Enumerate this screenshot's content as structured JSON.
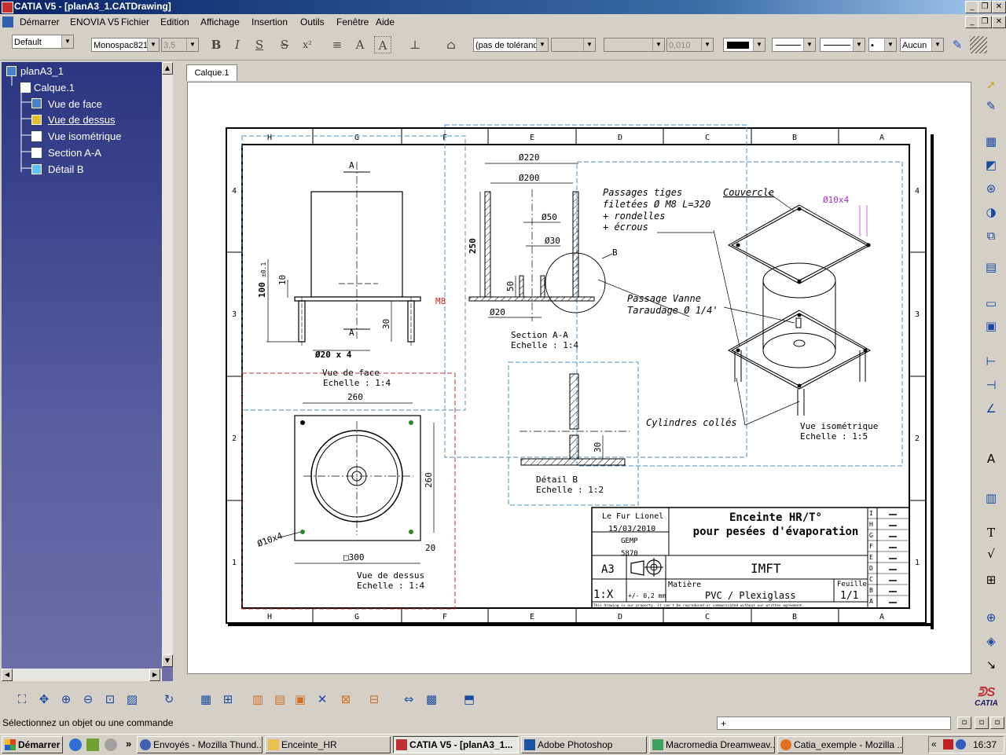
{
  "window": {
    "title": "CATIA V5 - [planA3_1.CATDrawing]"
  },
  "menu": [
    "Démarrer",
    "ENOVIA V5",
    "Fichier",
    "Edition",
    "Affichage",
    "Insertion",
    "Outils",
    "Fenêtre",
    "Aide"
  ],
  "toolbar": {
    "style_value": "Default",
    "font_value": "Monospac821",
    "font_size_value": "3,5",
    "bold": "B",
    "italic": "I",
    "underline": "S",
    "strike": "S",
    "superscript": "x²",
    "tolerance_value": "(pas de toléranc",
    "tol_value_2": "0,010",
    "pattern_value": "Aucun"
  },
  "tree": {
    "root": "planA3_1",
    "calque": "Calque.1",
    "views": [
      "Vue de face",
      "Vue de dessus",
      "Vue isométrique",
      "Section A-A",
      "Détail B"
    ]
  },
  "doc_tab": "Calque.1",
  "drawing": {
    "col_labels_top": [
      "H",
      "G",
      "F",
      "E",
      "D",
      "C",
      "B",
      "A"
    ],
    "col_labels_bottom": [
      "H",
      "G",
      "F",
      "E",
      "D",
      "C",
      "B",
      "A"
    ],
    "row_labels": [
      "4",
      "3",
      "2",
      "1"
    ],
    "front_view": {
      "caption": "Vue de face",
      "scale": "Echelle :    1:4",
      "dim_height": "100",
      "tol": "±0.1",
      "dim_10": "10",
      "dim_30": "30",
      "dim_dia": "Ø20 x 4",
      "label_m8": "M8",
      "sect_a": "A"
    },
    "top_view": {
      "caption": "Vue de dessus",
      "scale": "Echelle :    1:4",
      "dim_260h": "260",
      "dim_260v": "260",
      "dim_300": "□300",
      "dim_20": "20",
      "dim_holes": "Ø10x4"
    },
    "section": {
      "caption": "Section A-A",
      "scale": "Echelle :    1:4",
      "d220": "Ø220",
      "d200": "Ø200",
      "d50": "Ø50",
      "d30": "Ø30",
      "d20": "Ø20",
      "h250": "250",
      "h50": "50",
      "circle_label": "B"
    },
    "detail": {
      "caption": "Détail B",
      "scale": "Echelle :    1:2",
      "dim_30": "30"
    },
    "iso": {
      "caption": "Vue isométrique",
      "scale": "Echelle :    1:5",
      "couvercle": "Couvercle",
      "holes": "Ø10x4",
      "note_tiges": [
        "Passages tiges",
        "filetées  Ø M8 L=320",
        "+ rondelles",
        "+ écrous"
      ],
      "note_vanne": [
        "Passage Vanne",
        "Taraudage  Ø 1/4'"
      ],
      "cylindres": "Cylindres collés"
    },
    "titleblock": {
      "author": "Le Fur Lionel",
      "date": "15/03/2010",
      "group": "GEMP",
      "tel": "5870",
      "title1": "Enceinte HR/T°",
      "title2": "pour pesées d'évaporation",
      "format": "A3",
      "org": "IMFT",
      "scale": "1:X",
      "tolerance": "+/- 0,2 mm",
      "material_label": "Matière",
      "material": "PVC / Plexiglass",
      "sheet_label": "Feuille",
      "sheet": "1/1",
      "disclaimer": "This drawing is our property. it can't be reproduced or communicated without our written agreement.",
      "rev_letters": [
        "I",
        "H",
        "G",
        "F",
        "E",
        "D",
        "C",
        "B",
        "A"
      ]
    }
  },
  "status": {
    "message": "Sélectionnez un objet ou une commande",
    "command_input": "+"
  },
  "taskbar": {
    "start": "Démarrer",
    "items": [
      "Envoyés - Mozilla Thund...",
      "Enceinte_HR",
      "CATIA V5 - [planA3_1...",
      "Adobe Photoshop",
      "Macromedia Dreamweav...",
      "Catia_exemple - Mozilla ..."
    ],
    "clock": "16:37"
  },
  "brand": "CATIA"
}
